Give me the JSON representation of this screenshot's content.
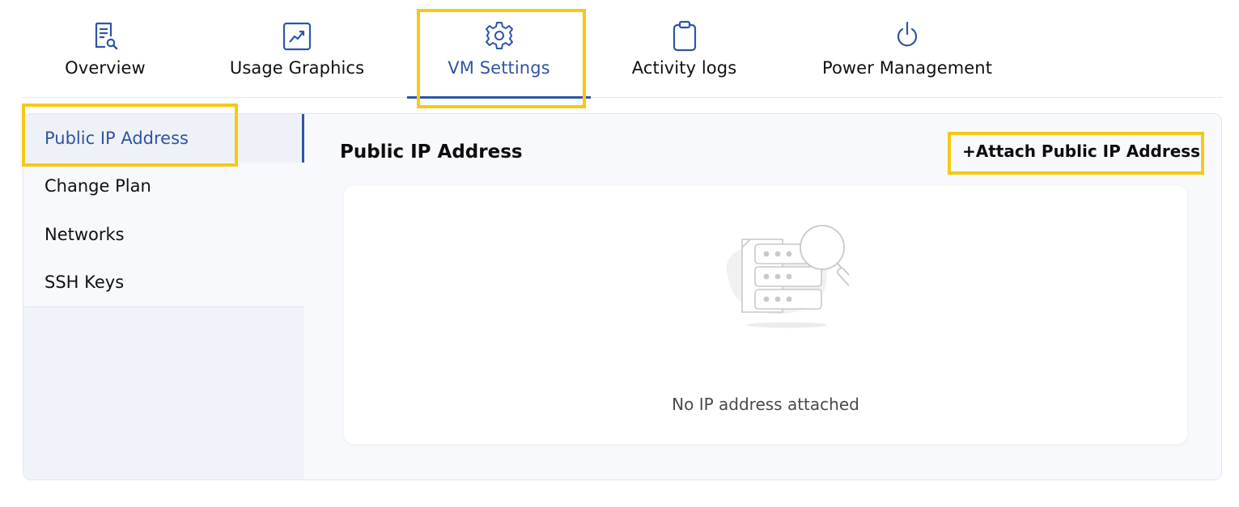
{
  "tabs": [
    {
      "label": "Overview",
      "icon": "document-search-icon"
    },
    {
      "label": "Usage Graphics",
      "icon": "chart-trend-icon"
    },
    {
      "label": "VM Settings",
      "icon": "gear-icon",
      "active": true
    },
    {
      "label": "Activity logs",
      "icon": "clipboard-icon"
    },
    {
      "label": "Power Management",
      "icon": "power-icon"
    }
  ],
  "sidebar": {
    "items": [
      {
        "label": "Public IP Address",
        "active": true
      },
      {
        "label": "Change Plan"
      },
      {
        "label": "Networks"
      },
      {
        "label": "SSH Keys"
      }
    ]
  },
  "main": {
    "title": "Public IP Address",
    "attach_label": "+Attach Public IP Address",
    "empty_message": "No IP address attached",
    "empty_icon": "server-search-illustration"
  },
  "colors": {
    "accent": "#2f55a4",
    "highlight": "#f7c816",
    "panel_bg": "#f8f9fc"
  }
}
